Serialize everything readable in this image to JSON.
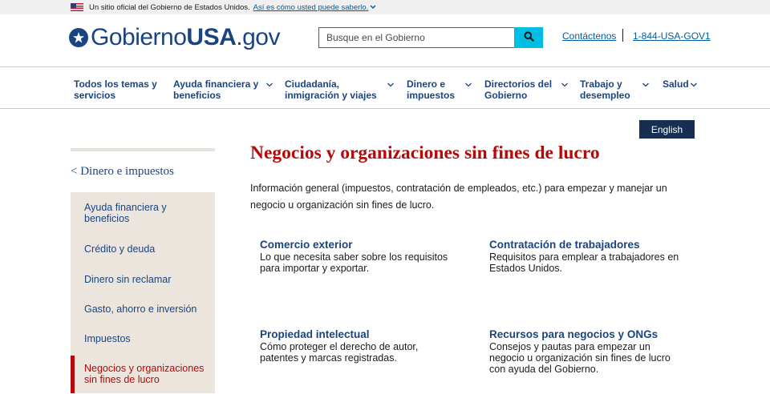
{
  "banner": {
    "text": "Un sitio oficial del Gobierno de Estados Unidos.",
    "link": "Así es cómo usted puede saberlo.",
    "flag_icon": "us-flag-icon",
    "chevron_icon": "chevron-down-icon"
  },
  "header": {
    "logo_prefix": "Gobierno",
    "logo_bold": "USA",
    "logo_suffix": ".gov",
    "logo_icon": "star-circle-icon",
    "search_placeholder": "Busque en el Gobierno",
    "search_icon": "search-icon",
    "contact_label": "Contáctenos",
    "phone_label": "1-844-USA-GOV1"
  },
  "nav": {
    "items": [
      {
        "label": "Todos los temas y servicios",
        "has_menu": false
      },
      {
        "label": "Ayuda financiera y beneficios",
        "has_menu": true
      },
      {
        "label": "Ciudadanía, inmigración y viajes",
        "has_menu": true
      },
      {
        "label": "Dinero e impuestos",
        "has_menu": true
      },
      {
        "label": "Directorios del Gobierno",
        "has_menu": true
      },
      {
        "label": "Trabajo y desempleo",
        "has_menu": true
      },
      {
        "label": "Salud",
        "has_menu": true
      }
    ]
  },
  "language_button": "English",
  "sidebar": {
    "back_label": "< Dinero e impuestos",
    "items": [
      {
        "label": "Ayuda financiera y beneficios",
        "active": false
      },
      {
        "label": "Crédito y deuda",
        "active": false
      },
      {
        "label": "Dinero sin reclamar",
        "active": false
      },
      {
        "label": "Gasto, ahorro e inversión",
        "active": false
      },
      {
        "label": "Impuestos",
        "active": false
      },
      {
        "label": "Negocios y organizaciones sin fines de lucro",
        "active": true
      }
    ]
  },
  "main": {
    "title": "Negocios y organizaciones sin fines de lucro",
    "intro": "Información general (impuestos, contratación de empleados, etc.) para empezar y manejar un negocio u organización sin fines de lucro.",
    "cards": [
      {
        "title": "Comercio exterior",
        "desc": "Lo que necesita saber sobre los requisitos para importar y exportar."
      },
      {
        "title": "Contratación de trabajadores",
        "desc": "Requisitos para emplear a trabajadores en Estados Unidos."
      },
      {
        "title": "Propiedad intelectual",
        "desc": "Cómo proteger el derecho de autor, patentes y marcas registradas."
      },
      {
        "title": "Recursos para negocios y ONGs",
        "desc": "Consejos y pautas para empezar un negocio u organización sin fines de lucro con ayuda del Gobierno."
      }
    ]
  },
  "colors": {
    "primary_blue": "#1a4480",
    "link_blue": "#005ea2",
    "accent_red": "#b50909",
    "search_button": "#00bde3",
    "english_button": "#162e51",
    "sidebar_bg": "#ebe5de"
  }
}
